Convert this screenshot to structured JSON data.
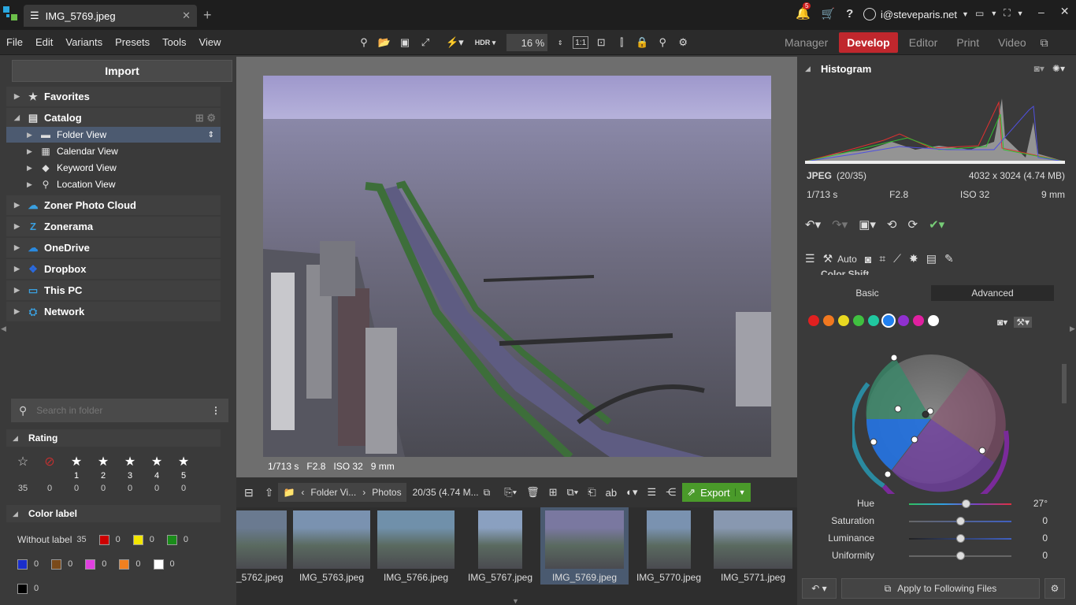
{
  "window": {
    "tab_title": "IMG_5769.jpeg",
    "notification_count": "5",
    "account": "i@steveparis.net"
  },
  "menu": [
    "File",
    "Edit",
    "Variants",
    "Presets",
    "Tools",
    "View"
  ],
  "toolbar": {
    "hdr_label": "HDR",
    "zoom_value": "16 %",
    "ratio_label": "1:1"
  },
  "modes": {
    "manager": "Manager",
    "develop": "Develop",
    "editor": "Editor",
    "print": "Print",
    "video": "Video"
  },
  "left_panel": {
    "import_label": "Import",
    "tree": [
      {
        "label": "Favorites",
        "icon": "star-icon"
      },
      {
        "label": "Catalog",
        "icon": "catalog-icon"
      },
      {
        "label": "Folder View",
        "icon": "folder-icon"
      },
      {
        "label": "Calendar View",
        "icon": "calendar-icon"
      },
      {
        "label": "Keyword View",
        "icon": "tag-icon"
      },
      {
        "label": "Location View",
        "icon": "pin-icon"
      },
      {
        "label": "Zoner Photo Cloud",
        "icon": "cloud-icon"
      },
      {
        "label": "Zonerama",
        "icon": "zonerama-icon"
      },
      {
        "label": "OneDrive",
        "icon": "onedrive-icon"
      },
      {
        "label": "Dropbox",
        "icon": "dropbox-icon"
      },
      {
        "label": "This PC",
        "icon": "pc-icon"
      },
      {
        "label": "Network",
        "icon": "network-icon"
      }
    ],
    "search_placeholder": "Search in folder",
    "rating": {
      "title": "Rating",
      "labels": [
        "",
        "",
        "1",
        "2",
        "3",
        "4",
        "5"
      ],
      "counts": [
        "35",
        "0",
        "0",
        "0",
        "0",
        "0",
        "0"
      ]
    },
    "color_label": {
      "title": "Color label",
      "without_label": "Without label",
      "without_count": "35",
      "items": [
        {
          "color": "#cc0000",
          "count": "0"
        },
        {
          "color": "#f2e600",
          "count": "0"
        },
        {
          "color": "#1a8c1a",
          "count": "0"
        },
        {
          "color": "#1a2ecc",
          "count": "0"
        },
        {
          "color": "#7a4a1a",
          "count": "0"
        },
        {
          "color": "#e040e0",
          "count": "0"
        },
        {
          "color": "#f08020",
          "count": "0"
        },
        {
          "color": "#ffffff",
          "count": "0"
        },
        {
          "color": "#000000",
          "count": "0"
        }
      ]
    }
  },
  "photo_info": {
    "shutter": "1/713 s",
    "aperture": "F2.8",
    "iso": "ISO 32",
    "focal": "9 mm"
  },
  "filmstrip_bar": {
    "breadcrumb_1": "Folder Vi...",
    "breadcrumb_2": "Photos",
    "count": "20/35 (4.74 M...",
    "export_label": "Export"
  },
  "filmstrip": [
    {
      "name": "_5762.jpeg"
    },
    {
      "name": "IMG_5763.jpeg"
    },
    {
      "name": "IMG_5766.jpeg"
    },
    {
      "name": "IMG_5767.jpeg"
    },
    {
      "name": "IMG_5769.jpeg"
    },
    {
      "name": "IMG_5770.jpeg"
    },
    {
      "name": "IMG_5771.jpeg"
    }
  ],
  "right_panel": {
    "histogram_title": "Histogram",
    "format": "JPEG",
    "index": "(20/35)",
    "dimensions": "4032 x 3024 (4.74 MB)",
    "shutter": "1/713 s",
    "aperture": "F2.8",
    "iso": "ISO 32",
    "focal": "9 mm",
    "auto_label": "Auto",
    "section_title": "Color Shift",
    "basic_tab": "Basic",
    "advanced_tab": "Advanced",
    "swatches": [
      "#e02020",
      "#f07820",
      "#e8d820",
      "#40c040",
      "#20c8a0",
      "#2080f0",
      "#9030d0",
      "#e020a0",
      "#ffffff"
    ],
    "sliders": [
      {
        "label": "Hue",
        "value": "27°",
        "level": 0.55
      },
      {
        "label": "Saturation",
        "value": "0",
        "level": 0.5
      },
      {
        "label": "Luminance",
        "value": "0",
        "level": 0.5
      },
      {
        "label": "Uniformity",
        "value": "0",
        "level": 0.5
      }
    ],
    "apply_label": "Apply to Following Files"
  }
}
